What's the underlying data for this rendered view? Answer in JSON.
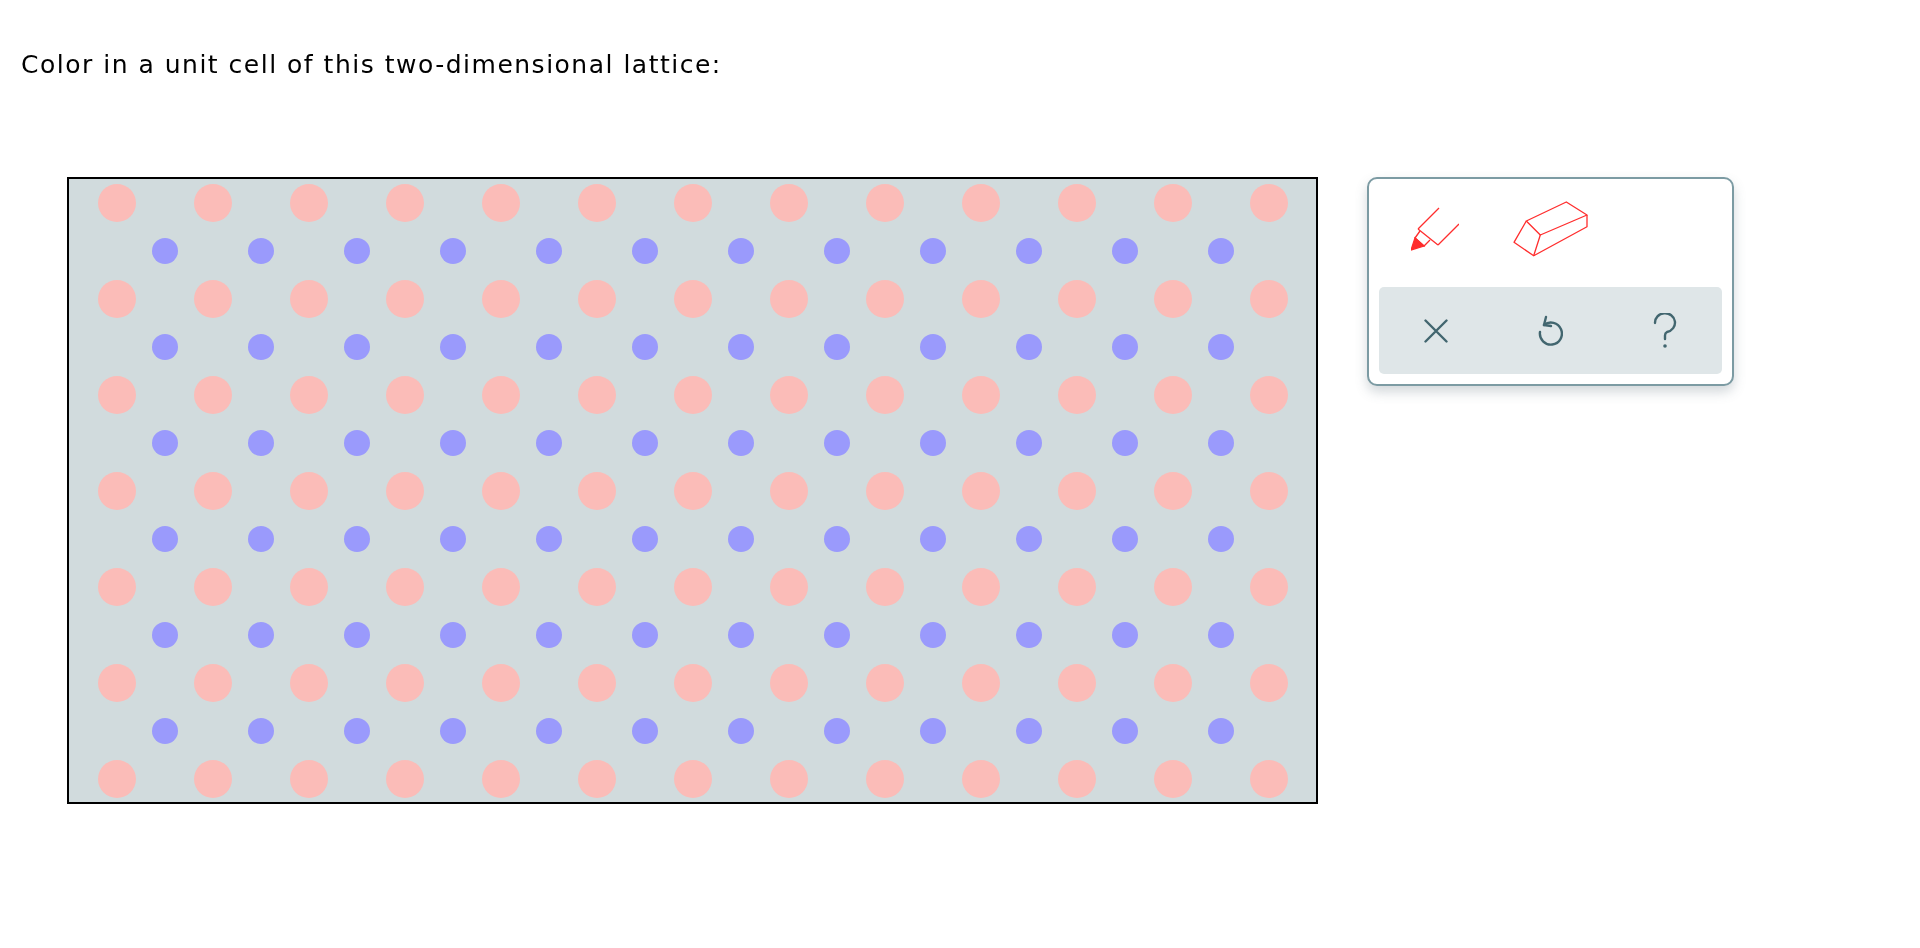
{
  "prompt": "Color in a unit cell of this two-dimensional lattice:",
  "lattice": {
    "sites": [
      {
        "kind": "large",
        "color": "#fbbcb8"
      },
      {
        "kind": "small",
        "color": "#9a9afc"
      }
    ]
  },
  "toolbox": {
    "tools": [
      {
        "kind": "marker"
      },
      {
        "kind": "eraser"
      }
    ],
    "actions": [
      {
        "kind": "clear"
      },
      {
        "kind": "undo"
      },
      {
        "kind": "help"
      }
    ]
  }
}
